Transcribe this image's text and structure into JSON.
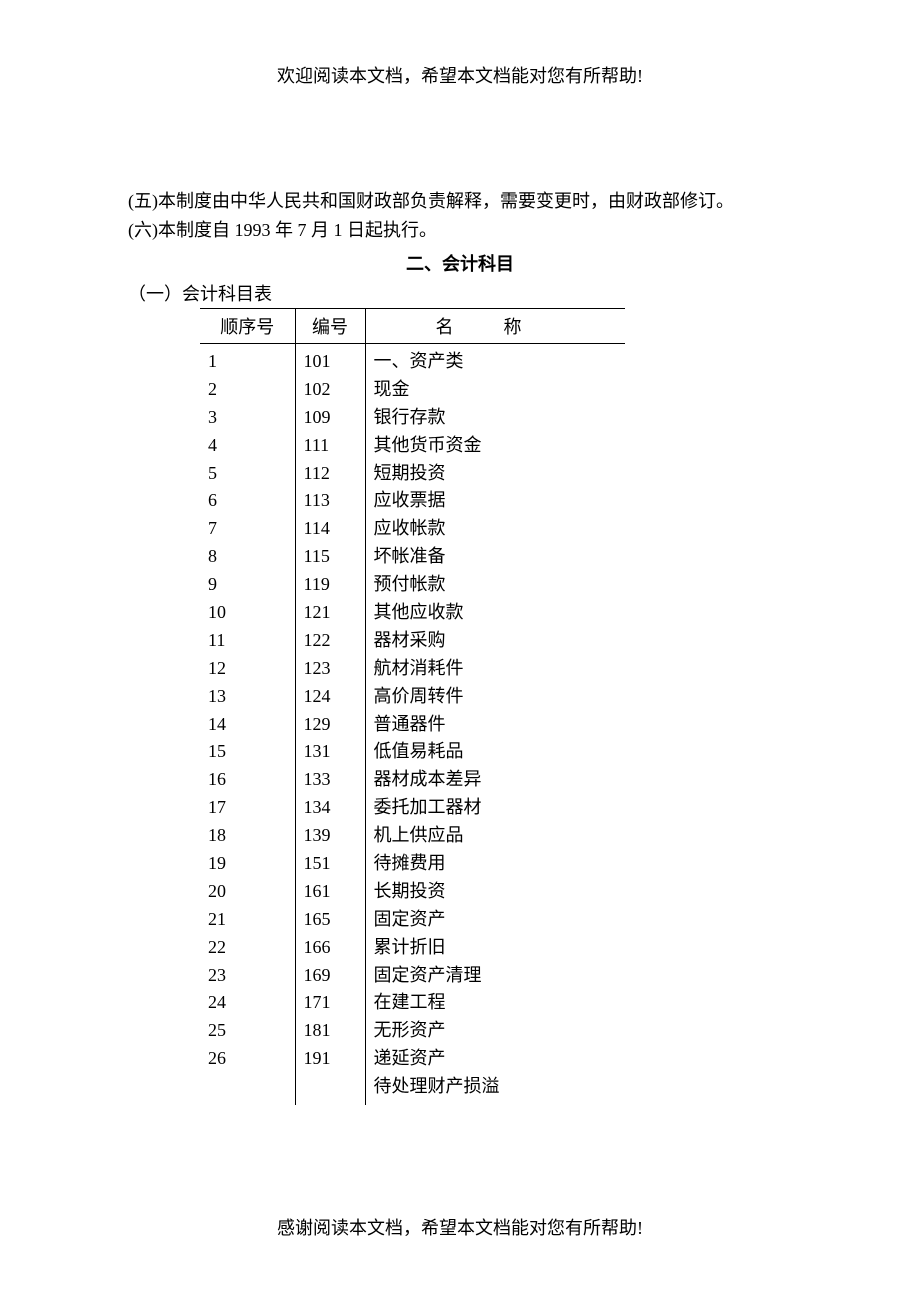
{
  "header_note": "欢迎阅读本文档，希望本文档能对您有所帮助!",
  "footer_note": "感谢阅读本文档，希望本文档能对您有所帮助!",
  "paragraphs": {
    "p1": "(五)本制度由中华人民共和国财政部负责解释，需要变更时，由财政部修订。",
    "p2": "(六)本制度自 1993 年 7 月 1 日起执行。"
  },
  "section_title": "二、会计科目",
  "subsection_title": "（一）会计科目表",
  "table": {
    "headers": {
      "seq": "顺序号",
      "code": "编号",
      "name": "名称"
    },
    "category_header": "一、资产类",
    "seq_list": [
      "1",
      "2",
      "3",
      "4",
      "5",
      "6",
      "7",
      "8",
      "9",
      "10",
      "11",
      "12",
      "13",
      "14",
      "15",
      "16",
      "17",
      "18",
      "19",
      "20",
      "21",
      "22",
      "23",
      "24",
      "25",
      "26"
    ],
    "code_list": [
      "101",
      "102",
      "109",
      "111",
      "112",
      "113",
      "114",
      "115",
      "119",
      "121",
      "122",
      "123",
      "124",
      "129",
      "131",
      "133",
      "134",
      "139",
      "151",
      "161",
      "165",
      "166",
      "169",
      "171",
      "181",
      "191"
    ],
    "name_list": [
      "现金",
      "银行存款",
      "其他货币资金",
      "短期投资",
      "应收票据",
      "应收帐款",
      "坏帐准备",
      "预付帐款",
      "其他应收款",
      "器材采购",
      "航材消耗件",
      "高价周转件",
      "普通器件",
      "低值易耗品",
      "器材成本差异",
      "委托加工器材",
      "机上供应品",
      "待摊费用",
      "长期投资",
      "固定资产",
      "累计折旧",
      "固定资产清理",
      "在建工程",
      "无形资产",
      "递延资产",
      "待处理财产损溢"
    ]
  }
}
